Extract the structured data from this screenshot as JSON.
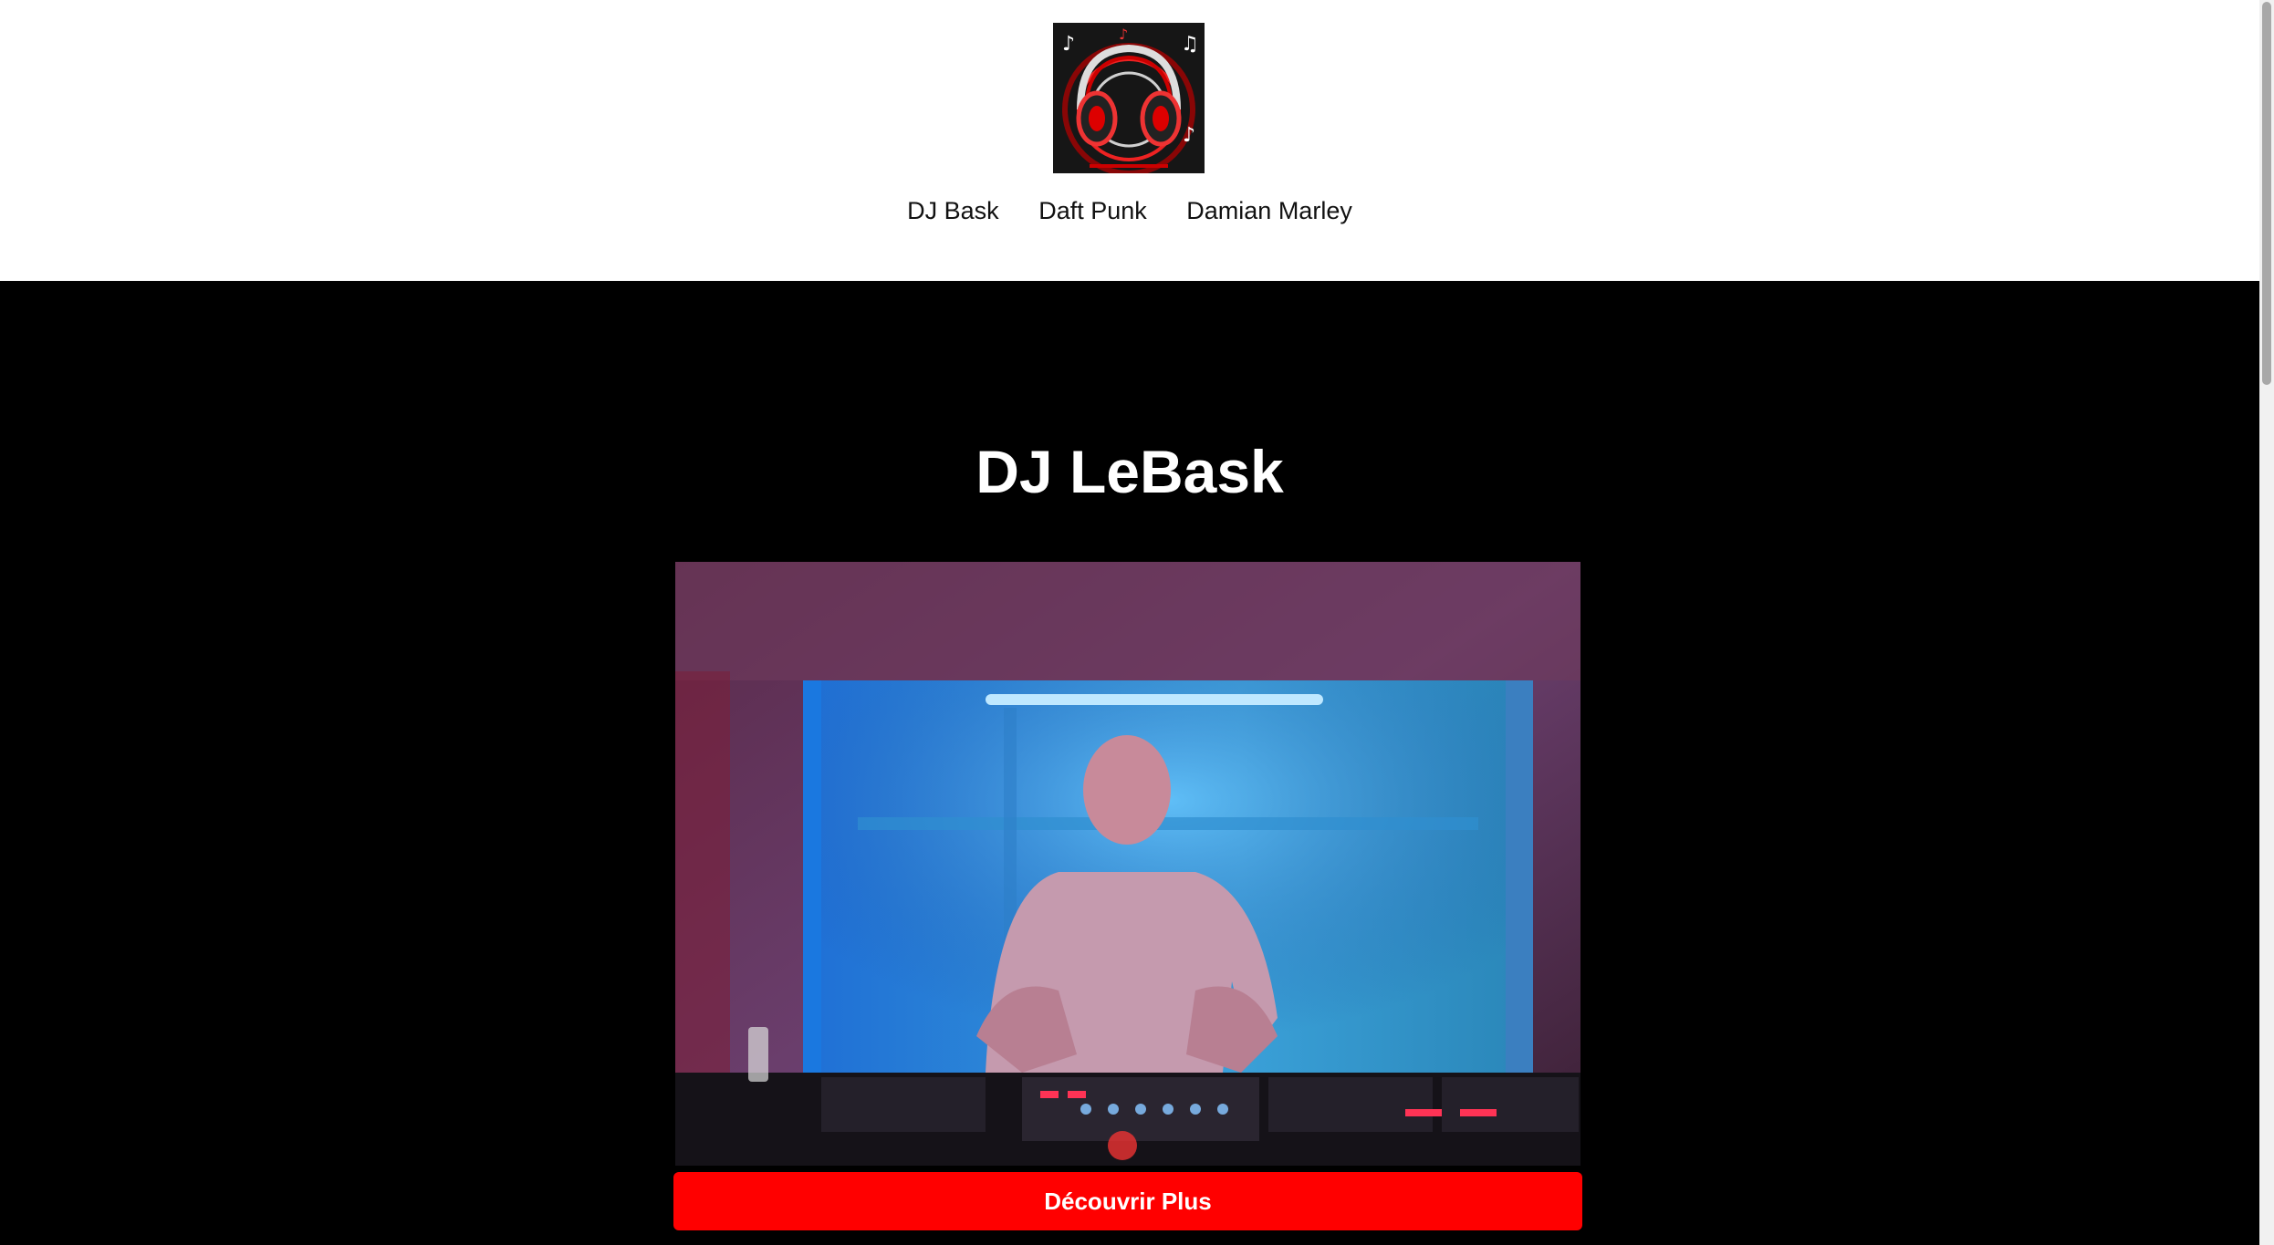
{
  "nav": {
    "items": [
      {
        "label": "DJ Bask"
      },
      {
        "label": "Daft Punk"
      },
      {
        "label": "Damian Marley"
      }
    ]
  },
  "hero": {
    "title": "DJ LeBask",
    "cta_label": "Découvrir Plus"
  },
  "colors": {
    "accent": "#ff0000",
    "header_bg": "#ffffff",
    "hero_bg": "#000000"
  },
  "icons": {
    "logo": "headphones-music-logo"
  }
}
